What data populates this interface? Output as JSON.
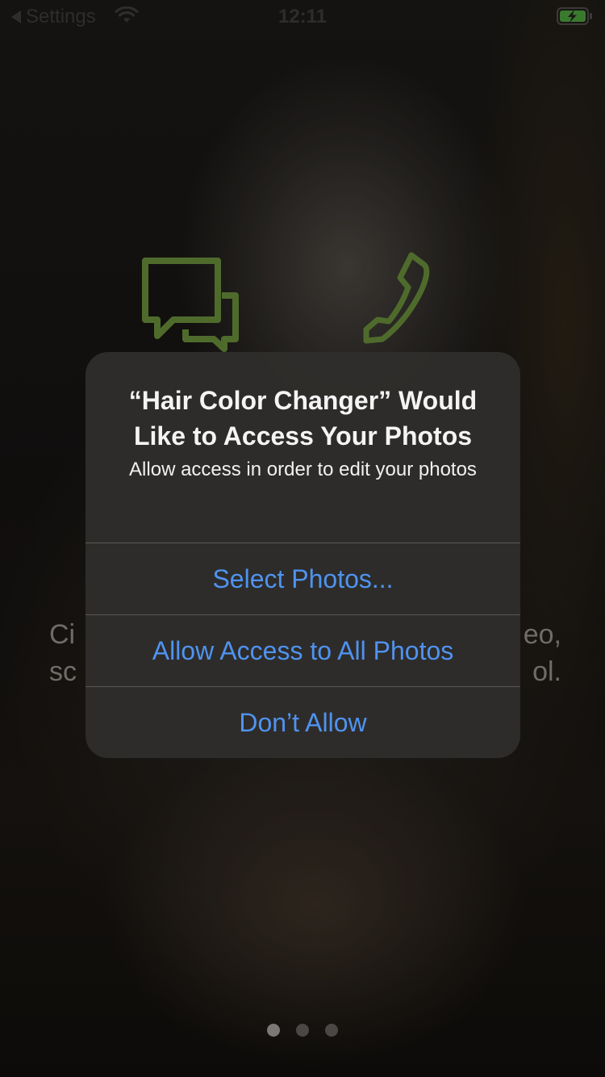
{
  "status_bar": {
    "back_label": "Settings",
    "time": "12:11",
    "icons": [
      "back-caret-icon",
      "wifi-icon",
      "battery-charging-icon"
    ],
    "battery_color": "#3fa33a"
  },
  "background": {
    "text_left": "Ci\nsc",
    "text_right": "eo,\nol.",
    "icons": [
      "chat-bubbles-icon",
      "phone-icon"
    ],
    "icon_color": "#4f6b2c",
    "page_dots": {
      "count": 3,
      "active_index": 0
    }
  },
  "alert": {
    "title": "“Hair Color Changer” Would Like to Access Your Photos",
    "message": "Allow access in order to edit your photos",
    "buttons": [
      {
        "label": "Select Photos..."
      },
      {
        "label": "Allow Access to All Photos"
      },
      {
        "label": "Don’t Allow"
      }
    ],
    "button_color": "#4f93f0"
  }
}
